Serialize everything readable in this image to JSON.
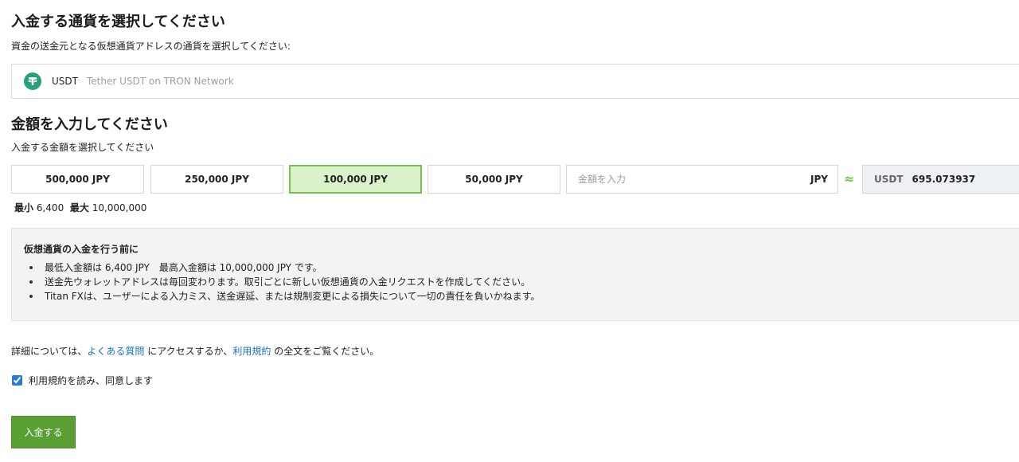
{
  "currency_section": {
    "title": "入金する通貨を選択してください",
    "subtitle": "資金の送金元となる仮想通貨アドレスの通貨を選択してください:",
    "selected": {
      "icon": "tether-icon",
      "code": "USDT",
      "name": "Tether USDT on TRON Network"
    }
  },
  "amount_section": {
    "title": "金額を入力してください",
    "subtitle": "入金する金額を選択してください",
    "presets": [
      {
        "label": "500,000 JPY",
        "selected": false
      },
      {
        "label": "250,000 JPY",
        "selected": false
      },
      {
        "label": "100,000 JPY",
        "selected": true
      },
      {
        "label": "50,000 JPY",
        "selected": false
      }
    ],
    "input": {
      "placeholder": "金額を入力",
      "value": "",
      "unit": "JPY"
    },
    "approx_symbol": "≈",
    "converted": {
      "unit": "USDT",
      "value": "695.073937"
    },
    "min_label": "最小",
    "min_value": "6,400",
    "max_label": "最大",
    "max_value": "10,000,000"
  },
  "notice": {
    "title": "仮想通貨の入金を行う前に",
    "items": [
      "最低入金額は 6,400 JPY　最高入金額は 10,000,000 JPY です。",
      "送金先ウォレットアドレスは毎回変わります。取引ごとに新しい仮想通貨の入金リクエストを作成してください。",
      "Titan FXは、ユーザーによる入力ミス、送金遅延、または規制変更による損失について一切の責任を負いかねます。"
    ]
  },
  "details": {
    "prefix": "詳細については、",
    "faq_link": "よくある質問",
    "middle": " にアクセスするか、",
    "terms_link": "利用規約",
    "suffix": " の全文をご覧ください。"
  },
  "agreement": {
    "label": "利用規約を読み、同意します",
    "checked": true
  },
  "submit": {
    "label": "入金する"
  },
  "colors": {
    "accent_green": "#5a9f33",
    "selected_bg": "#d9f2c9",
    "link": "#1a73c8",
    "tether": "#26a17b"
  }
}
